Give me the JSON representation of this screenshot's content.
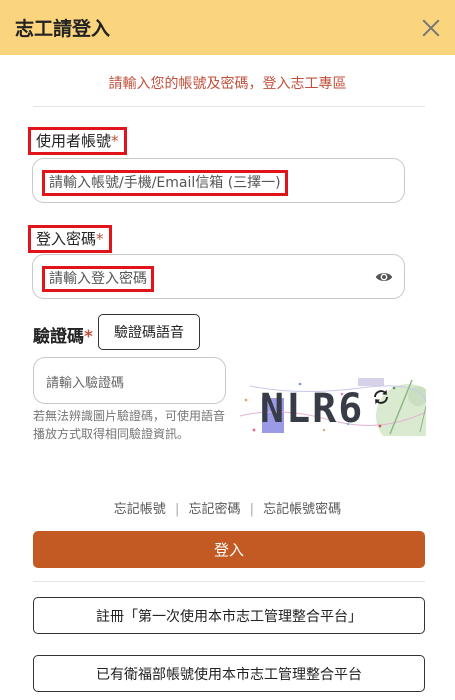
{
  "header": {
    "title": "志工請登入"
  },
  "subtitle": "請輸入您的帳號及密碼，登入志工專區",
  "account": {
    "label": "使用者帳號",
    "required_mark": "*",
    "placeholder": "請輸入帳號/手機/Email信箱 (三擇一)"
  },
  "password": {
    "label": "登入密碼",
    "required_mark": "*",
    "placeholder": "請輸入登入密碼"
  },
  "captcha": {
    "label": "驗證碼",
    "required_mark": "*",
    "voice_button": "驗證碼語音",
    "placeholder": "請輸入驗證碼",
    "hint": "若無法辨識圖片驗證碼，可使用語音播放方式取得相同驗證資訊。",
    "image_text": "NLR6"
  },
  "links": {
    "forgot_account": "忘記帳號",
    "forgot_password": "忘記密碼",
    "forgot_both": "忘記帳號密碼",
    "separator": "|"
  },
  "buttons": {
    "login": "登入",
    "register": "註冊「第一次使用本市志工管理整合平台」",
    "existing": "已有衛福部帳號使用本市志工管理整合平台"
  },
  "colors": {
    "header_bg": "#fbd47e",
    "accent": "#c35a24",
    "subtitle": "#c0503b",
    "highlight_box": "#e0141a"
  },
  "icons": {
    "close": "close-icon",
    "eye": "eye-icon",
    "refresh": "refresh-icon"
  }
}
